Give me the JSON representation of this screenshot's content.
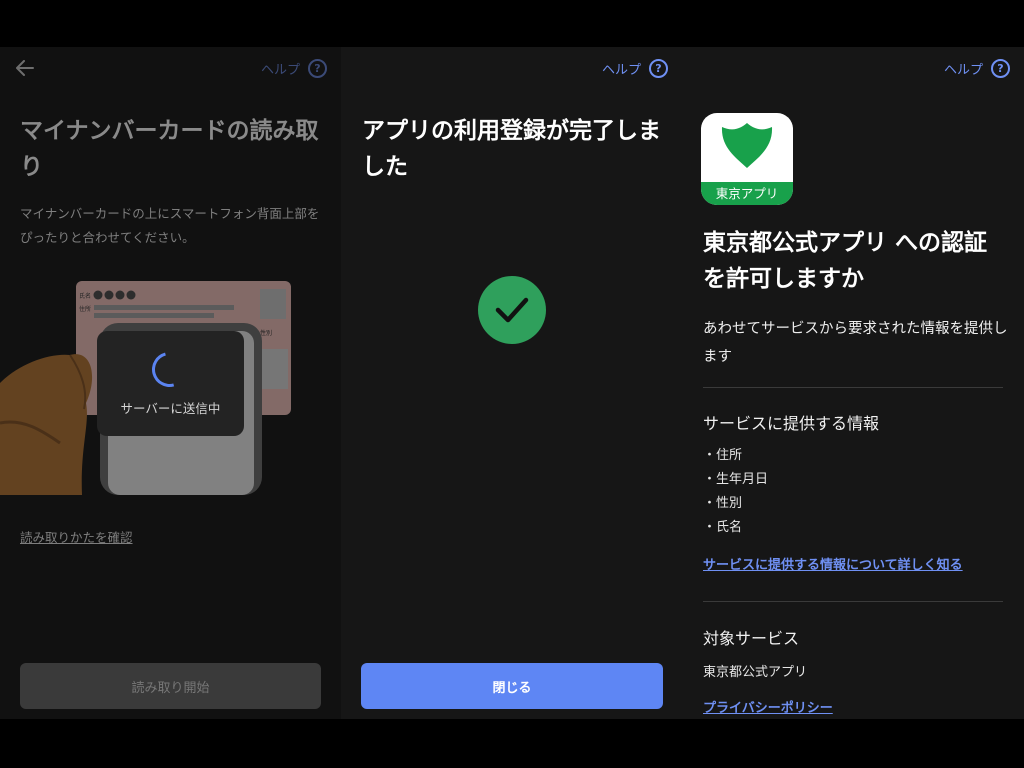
{
  "colors": {
    "accent": "#6f90f3",
    "primary_button": "#5e86f4",
    "success": "#2fa05c",
    "app_green": "#18a14b",
    "background": "#161616"
  },
  "panel1": {
    "help_label": "ヘルプ",
    "help_icon": "question-circle-icon",
    "back_icon": "arrow-left-icon",
    "title": "マイナンバーカードの読み取り",
    "description": "マイナンバーカードの上にスマートフォン背面上部をぴったりと合わせてください。",
    "sending_label": "サーバーに送信中",
    "card_label_name": "氏名",
    "card_label_address": "住所",
    "card_label_sex": "性別",
    "how_to_link": "読み取りかたを確認",
    "start_button": "読み取り開始"
  },
  "panel2": {
    "help_label": "ヘルプ",
    "help_icon": "question-circle-icon",
    "title": "アプリの利用登録が完了しました",
    "success_icon": "check-circle-icon",
    "close_button": "閉じる"
  },
  "panel3": {
    "help_label": "ヘルプ",
    "help_icon": "question-circle-icon",
    "app_icon_label": "東京アプリ",
    "title": "東京都公式アプリ への認証を許可しますか",
    "subtitle": "あわせてサービスから要求された情報を提供します",
    "info_heading": "サービスに提供する情報",
    "info_items": [
      "・住所",
      "・生年月日",
      "・性別",
      "・氏名"
    ],
    "info_link": "サービスに提供する情報について詳しく知る",
    "target_heading": "対象サービス",
    "target_service": "東京都公式アプリ",
    "privacy_link": "プライバシーポリシー"
  }
}
